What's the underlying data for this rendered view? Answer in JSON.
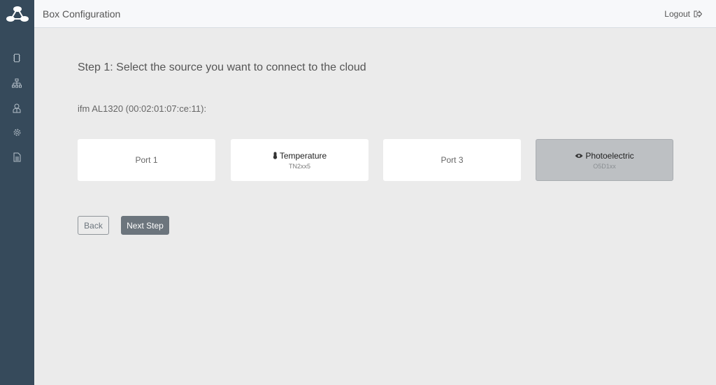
{
  "app": {
    "title": "Box Configuration",
    "logout_label": "Logout"
  },
  "sidebar": {
    "items": [
      {
        "icon": "chip-icon"
      },
      {
        "icon": "network-icon"
      },
      {
        "icon": "users-icon"
      },
      {
        "icon": "gear-icon"
      },
      {
        "icon": "document-icon"
      }
    ]
  },
  "main": {
    "step_title": "Step 1: Select the source you want to connect to the cloud",
    "device_label": "ifm AL1320 (00:02:01:07:ce:11):",
    "ports": [
      {
        "label": "Port 1",
        "selected": false
      },
      {
        "label": "Temperature",
        "sub": "TN2xx5",
        "icon": "thermometer-icon",
        "selected": false
      },
      {
        "label": "Port 3",
        "selected": false
      },
      {
        "label": "Photoelectric",
        "sub": "O5D1xx",
        "icon": "eye-icon",
        "selected": true
      }
    ],
    "back_label": "Back",
    "next_label": "Next Step"
  }
}
